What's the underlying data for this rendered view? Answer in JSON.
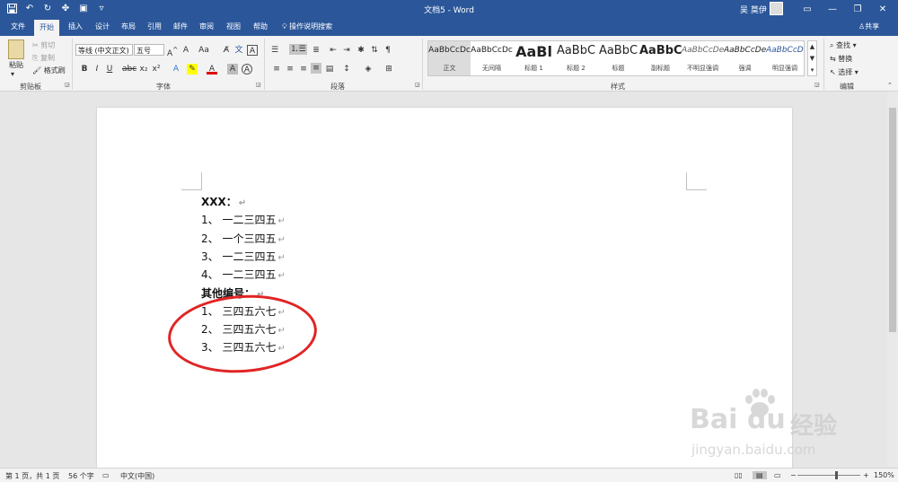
{
  "titlebar": {
    "title": "文档5 - Word",
    "user": "吴 莫伊",
    "qat_icons": [
      "save-icon",
      "undo-icon",
      "redo-icon",
      "customize-icon",
      "print-preview-icon",
      "qat-dropdown-icon"
    ],
    "min": "—",
    "restore": "❐",
    "close": "✕",
    "ribbon_opts": "▭"
  },
  "tabs": [
    "文件",
    "开始",
    "插入",
    "设计",
    "布局",
    "引用",
    "邮件",
    "审阅",
    "视图",
    "帮助"
  ],
  "active_tab": "开始",
  "tellme": "操作说明搜索",
  "share": "共享",
  "clipboard": {
    "paste": "粘贴",
    "cut": "剪切",
    "copy": "复制",
    "format_painter": "格式刷",
    "label": "剪贴板"
  },
  "font": {
    "name": "等线 (中文正文)",
    "size": "五号",
    "label": "字体",
    "buttons": [
      "B",
      "I",
      "U",
      "abc",
      "x₂",
      "x²",
      "A",
      "A",
      "A",
      "A"
    ]
  },
  "paragraph": {
    "label": "段落"
  },
  "styles": {
    "label": "样式",
    "items": [
      {
        "sample": "AaBbCcDc",
        "name": "正文"
      },
      {
        "sample": "AaBbCcDc",
        "name": "无间隔"
      },
      {
        "sample": "AaBl",
        "name": "标题 1"
      },
      {
        "sample": "AaBbC",
        "name": "标题 2"
      },
      {
        "sample": "AaBbC",
        "name": "标题"
      },
      {
        "sample": "AaBbC",
        "name": "副标题"
      },
      {
        "sample": "AaBbCcDe",
        "name": "不明显强调"
      },
      {
        "sample": "AaBbCcDe",
        "name": "强调"
      },
      {
        "sample": "AaBbCcDe",
        "name": "明显强调"
      }
    ]
  },
  "editing": {
    "find": "查找",
    "replace": "替换",
    "select": "选择",
    "label": "编辑"
  },
  "document": {
    "lines": [
      {
        "text": "XXX：",
        "bold": true
      },
      {
        "text": "1、 一二三四五",
        "bold": false
      },
      {
        "text": "2、 一个三四五",
        "bold": false
      },
      {
        "text": "3、 一二三四五",
        "bold": false
      },
      {
        "text": "4、 一二三四五",
        "bold": false
      },
      {
        "text": "其他编号：",
        "bold": true
      },
      {
        "text": "1、 三四五六七",
        "bold": false
      },
      {
        "text": "2、 三四五六七",
        "bold": false
      },
      {
        "text": "3、 三四五六七",
        "bold": false
      }
    ],
    "para_mark": "↵"
  },
  "watermark": {
    "brand": "Bai du",
    "zh": "经验",
    "url": "jingyan.baidu.com"
  },
  "status": {
    "page": "第 1 页，共 1 页",
    "words": "56 个字",
    "lang": "中文(中国)",
    "zoom": "150%"
  },
  "colors": {
    "accent": "#2b579a",
    "annotation": "#e12424"
  }
}
